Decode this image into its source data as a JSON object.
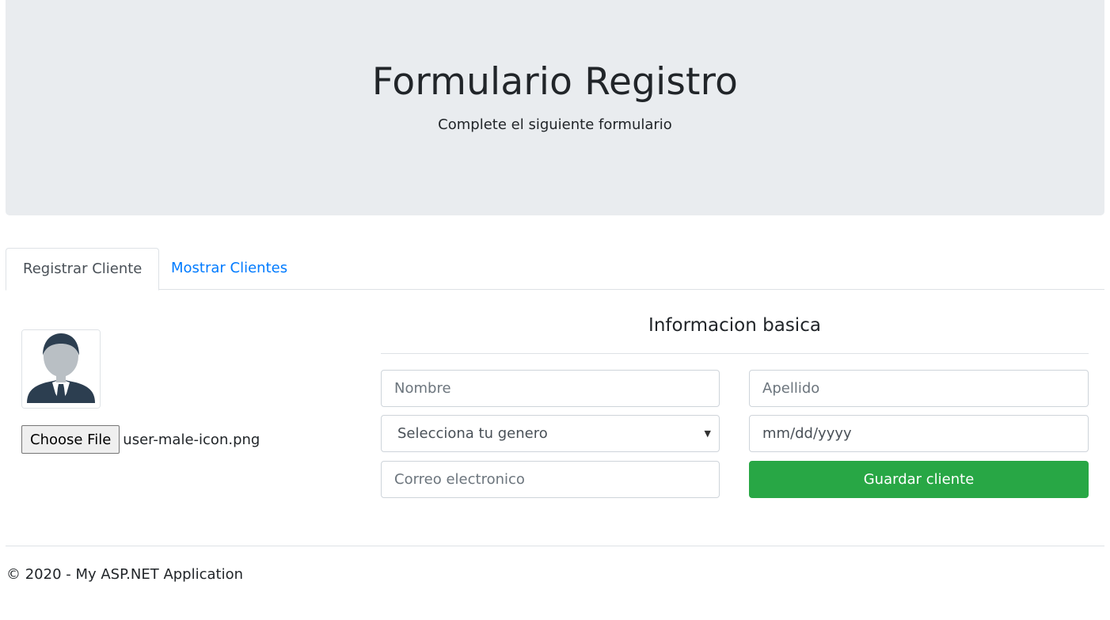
{
  "header": {
    "title": "Formulario Registro",
    "subtitle": "Complete el siguiente formulario"
  },
  "tabs": [
    {
      "label": "Registrar Cliente",
      "active": true
    },
    {
      "label": "Mostrar Clientes",
      "active": false
    }
  ],
  "photo": {
    "avatar_icon": "user-male-icon",
    "choose_file_label": "Choose File",
    "file_name": "user-male-icon.png"
  },
  "form": {
    "section_title": "Informacion basica",
    "nombre_placeholder": "Nombre",
    "apellido_placeholder": "Apellido",
    "genero_selected": "Selecciona tu genero",
    "fecha_placeholder": "mm/dd/yyyy",
    "correo_placeholder": "Correo electronico",
    "save_label": "Guardar cliente"
  },
  "footer": {
    "text": "© 2020 - My ASP.NET Application"
  },
  "colors": {
    "jumbotron_bg": "#e9ecef",
    "link": "#007bff",
    "success": "#28a745"
  }
}
